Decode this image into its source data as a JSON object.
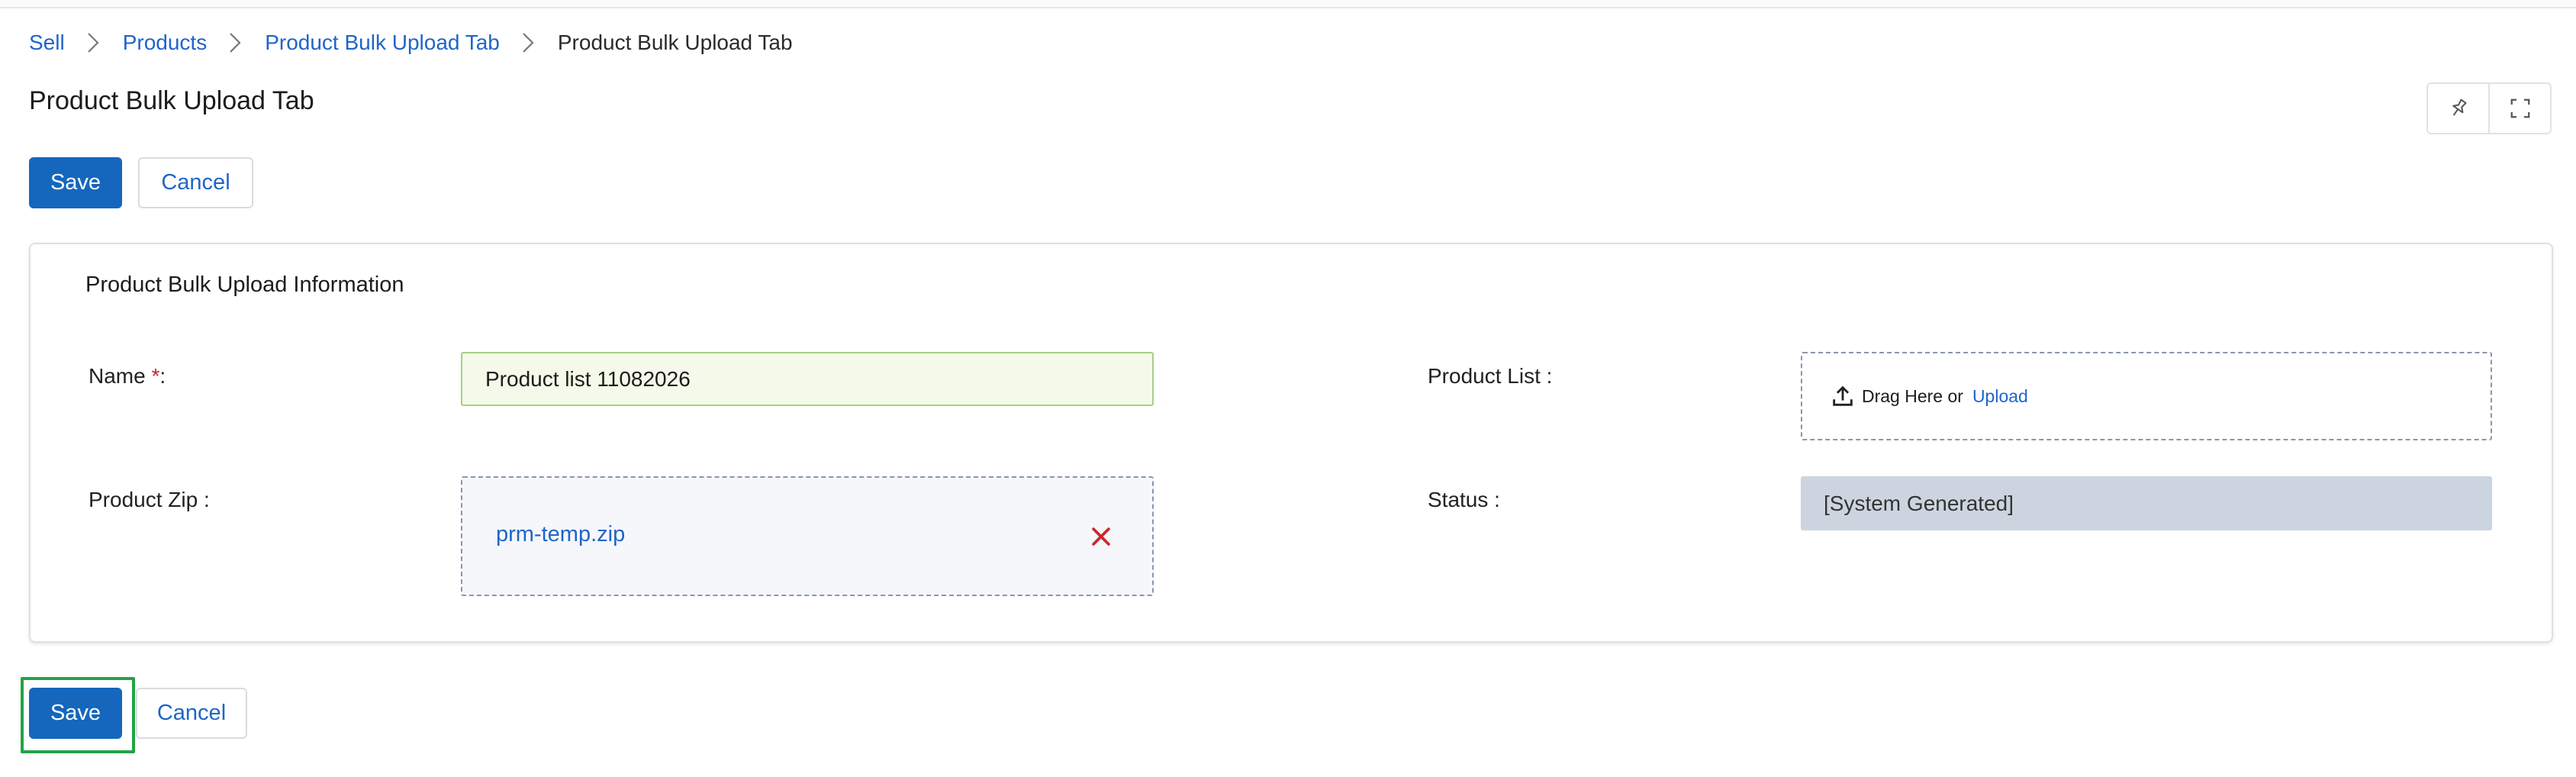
{
  "breadcrumb": {
    "items": [
      {
        "label": "Sell",
        "link": true
      },
      {
        "label": "Products",
        "link": true
      },
      {
        "label": "Product Bulk Upload Tab",
        "link": true
      },
      {
        "label": "Product Bulk Upload Tab",
        "link": false
      }
    ]
  },
  "header": {
    "title": "Product Bulk Upload Tab",
    "tools": [
      "pin-icon",
      "expand-icon"
    ]
  },
  "top_actions": {
    "save_label": "Save",
    "cancel_label": "Cancel"
  },
  "section": {
    "title": "Product Bulk Upload Information",
    "name_label": "Name ",
    "required_mark": "*",
    "name_colon": ":",
    "name_value": "Product list 11082026",
    "product_list_label": "Product List :",
    "drop_text": "Drag Here or",
    "upload_link": "Upload",
    "product_zip_label": "Product Zip :",
    "zip_file": "prm-temp.zip",
    "status_label": "Status :",
    "status_value": "[System Generated]"
  },
  "bottom_actions": {
    "save_label": "Save",
    "cancel_label": "Cancel"
  },
  "colors": {
    "primary": "#1467bd",
    "link": "#1f65c8",
    "required": "#c8252c",
    "remove": "#d0262d",
    "focus": "#21a446"
  }
}
